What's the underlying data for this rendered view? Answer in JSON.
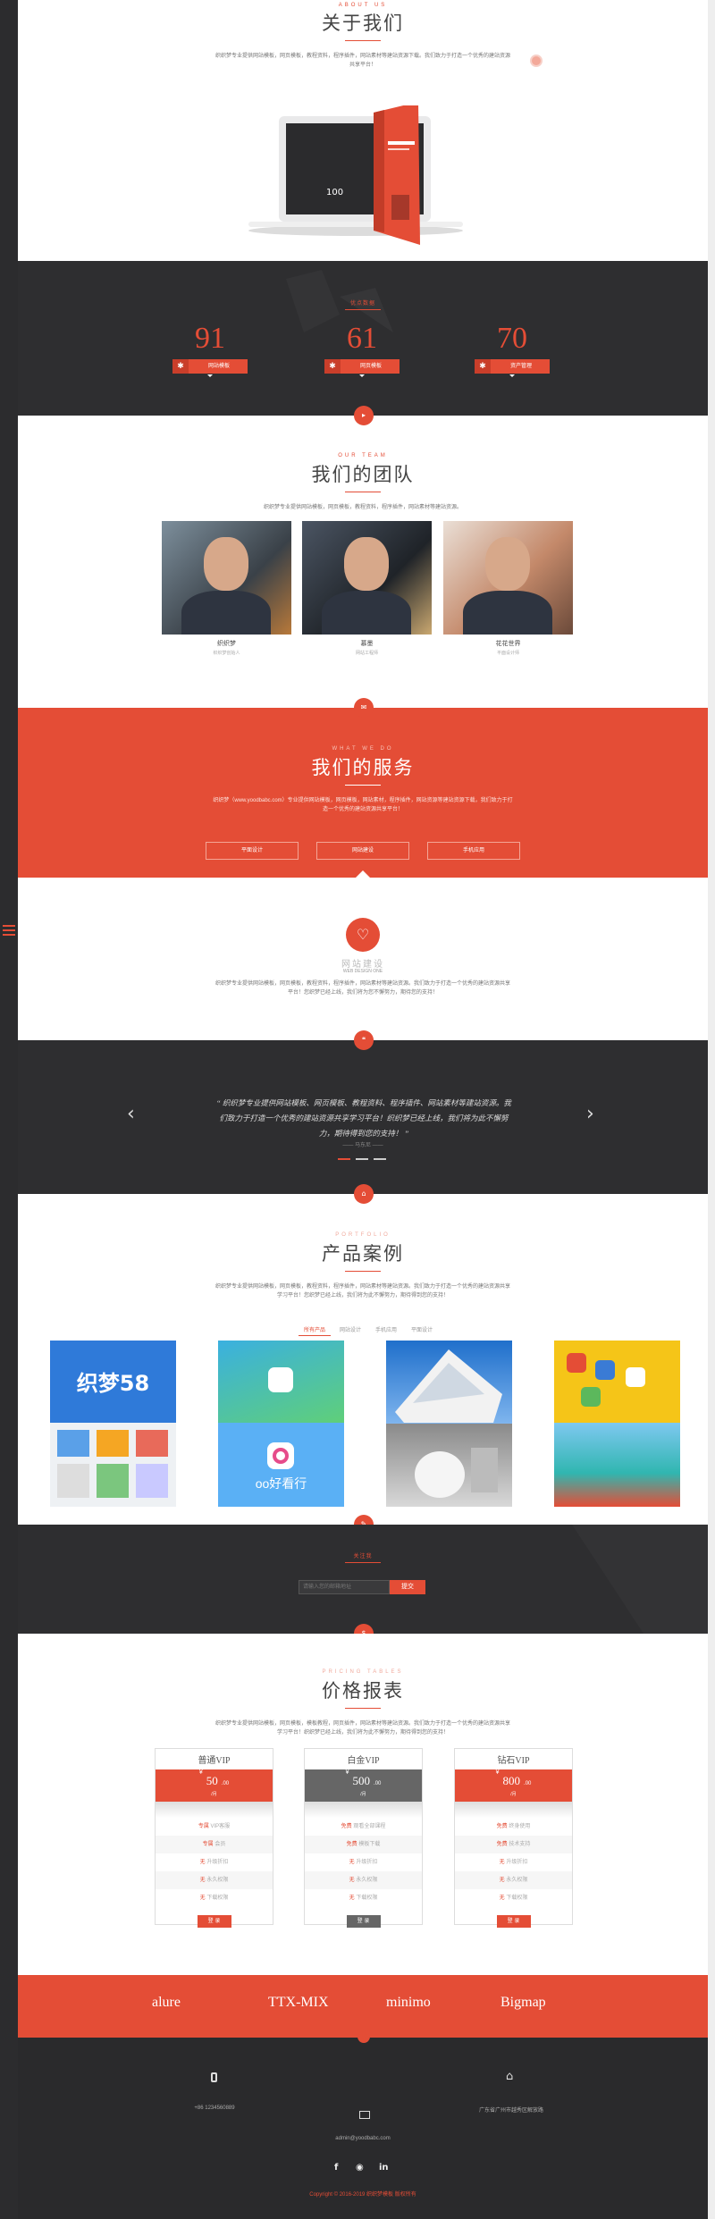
{
  "colors": {
    "accent": "#e44d36",
    "dark": "#2e2e30",
    "white": "#ffffff"
  },
  "about": {
    "sub": "ABOUT US",
    "title": "关于我们",
    "desc": "织织梦专业提供网站模板，网页模板，教程资料，程序插件，网站素材等建站资源下载。我们致力于打造一个优秀的建站资源共享平台！",
    "book_badge": "100"
  },
  "stats": {
    "sub": "优点数据",
    "items": [
      {
        "value": "91",
        "label": "网站模板",
        "icon": "cat-icon"
      },
      {
        "value": "61",
        "label": "网页模板",
        "icon": "rocket-icon"
      },
      {
        "value": "70",
        "label": "资产管理",
        "icon": "monitor-icon"
      }
    ]
  },
  "team": {
    "sub": "OUR TEAM",
    "title": "我们的团队",
    "desc": "织织梦专业提供网站模板，网页模板，教程资料，程序插件，网站素材等建站资源。",
    "members": [
      {
        "name": "织织梦",
        "role": "织织梦创始人"
      },
      {
        "name": "慕墨",
        "role": "网站工程师"
      },
      {
        "name": "花花世界",
        "role": "平面设计师"
      }
    ]
  },
  "services": {
    "sub": "WHAT WE DO",
    "title": "我们的服务",
    "desc": "织织梦（www.yoodbabc.com）专业提供网站模板，网页模板，网站素材，程序插件，网站资源等建站资源下载，我们致力于打造一个优秀的建站资源共享平台！",
    "buttons": [
      "平面设计",
      "网站建设",
      "手机应用"
    ]
  },
  "service_detail": {
    "title": "网站建设",
    "sub": "WEB DESIGN ONE",
    "desc": "织织梦专业提供网站模板，网页模板，教程资料，程序插件，网站素材等建站资源。我们致力于打造一个优秀的建站资源共享平台！您织梦已经上线，我们将为您不懈努力，期待您的支持！"
  },
  "testimonial": {
    "quote": "“ 织织梦专业提供网站模板、网页模板、教程资料、程序插件、网站素材等建站资源。我们致力于打造一个优秀的建站资源共享学习平台！织织梦已经上线，我们将为此不懈努力，期待得到您的支持！ ”",
    "author": "—— 马东尼 ——"
  },
  "portfolio": {
    "sub": "PORTFOLIO",
    "title": "产品案例",
    "desc": "织织梦专业提供网站模板，网页模板，教程资料，程序插件，网站素材等建站资源。我们致力于打造一个优秀的建站资源共享学习平台！您织梦已经上线，我们将为此不懈努力，期待得到您的支持！",
    "tabs": [
      "所有产品",
      "网站设计",
      "手机应用",
      "平面设计"
    ],
    "dede_logo": "织梦58",
    "oo_label": "oo好看行"
  },
  "subscribe": {
    "sub": "关注我",
    "placeholder": "请输入您的邮箱地址",
    "button": "提交"
  },
  "pricing": {
    "sub": "PRICING TABLES",
    "title": "价格报表",
    "desc": "织织梦专业提供网站模板，网页模板，模板教程，网页插件，网站素材等建站资源。我们致力于打造一个优秀的建站资源共享学习平台！织织梦已经上线，我们将为此不懈努力，期待得到您的支持！",
    "plans": [
      {
        "name": "普通VIP",
        "currency": "¥",
        "price": "50",
        "cents": ".00",
        "period": "/月",
        "features": [
          [
            "专属",
            "VIP客服"
          ],
          [
            "专属",
            "会员"
          ],
          [
            "无",
            "升级折扣"
          ],
          [
            "无",
            "永久权限"
          ],
          [
            "无",
            "下载权限"
          ]
        ],
        "button": "登 录"
      },
      {
        "name": "白金VIP",
        "currency": "¥",
        "price": "500",
        "cents": ".00",
        "period": "/月",
        "features": [
          [
            "免费",
            "观看全部课程"
          ],
          [
            "免费",
            "模板下载"
          ],
          [
            "无",
            "升级折扣"
          ],
          [
            "无",
            "永久权限"
          ],
          [
            "无",
            "下载权限"
          ]
        ],
        "button": "登 录"
      },
      {
        "name": "钻石VIP",
        "currency": "¥",
        "price": "800",
        "cents": ".00",
        "period": "/月",
        "features": [
          [
            "免费",
            "终身使用"
          ],
          [
            "免费",
            "技术支持"
          ],
          [
            "无",
            "升级折扣"
          ],
          [
            "无",
            "永久权限"
          ],
          [
            "无",
            "下载权限"
          ]
        ],
        "button": "登 录"
      }
    ]
  },
  "brands": [
    "alure",
    "TTX-MIX",
    "minimo",
    "Bigmap"
  ],
  "footer": {
    "phone": "+86 1234560889",
    "email": "admin@yoodbabc.com",
    "address": "广东省广州市越秀区解放路",
    "copyright": "Copyright © 2016-2019 织织梦模板 版权所有"
  }
}
